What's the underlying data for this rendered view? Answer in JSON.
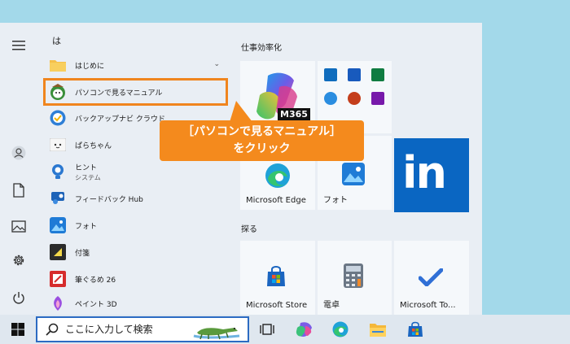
{
  "start_menu": {
    "letter_heading": "は",
    "apps": [
      {
        "label": "はじめに",
        "icon": "folder-icon"
      },
      {
        "label": "パソコンで見るマニュアル",
        "icon": "manual-icon"
      },
      {
        "label": "バックアップナビ クラウド",
        "icon": "backup-navi-icon"
      },
      {
        "label": "ぱらちゃん",
        "icon": "parachan-icon"
      },
      {
        "label": "ヒント",
        "sub": "システム",
        "icon": "tips-icon"
      },
      {
        "label": "フィードバック Hub",
        "icon": "feedback-hub-icon"
      },
      {
        "label": "フォト",
        "icon": "photos-icon"
      },
      {
        "label": "付箋",
        "icon": "sticky-notes-icon"
      },
      {
        "label": "筆ぐるめ 26",
        "icon": "fudegurume-icon"
      },
      {
        "label": "ペイント 3D",
        "icon": "paint-3d-icon"
      }
    ],
    "groups": [
      {
        "title": "仕事効率化"
      },
      {
        "title": "探る"
      }
    ],
    "tiles": {
      "m365": "M365",
      "edge": "Microsoft Edge",
      "photos": "フォト",
      "store": "Microsoft Store",
      "calc": "電卓",
      "todo": "Microsoft To..."
    }
  },
  "callout": {
    "line1": "［パソコンで見るマニュアル］",
    "line2": "をクリック"
  },
  "taskbar": {
    "search_placeholder": "ここに入力して検索"
  },
  "colors": {
    "highlight": "#f0851e",
    "callout": "#f48a1d",
    "linkedin": "#0a66c2",
    "accent": "#2c6bc2"
  }
}
